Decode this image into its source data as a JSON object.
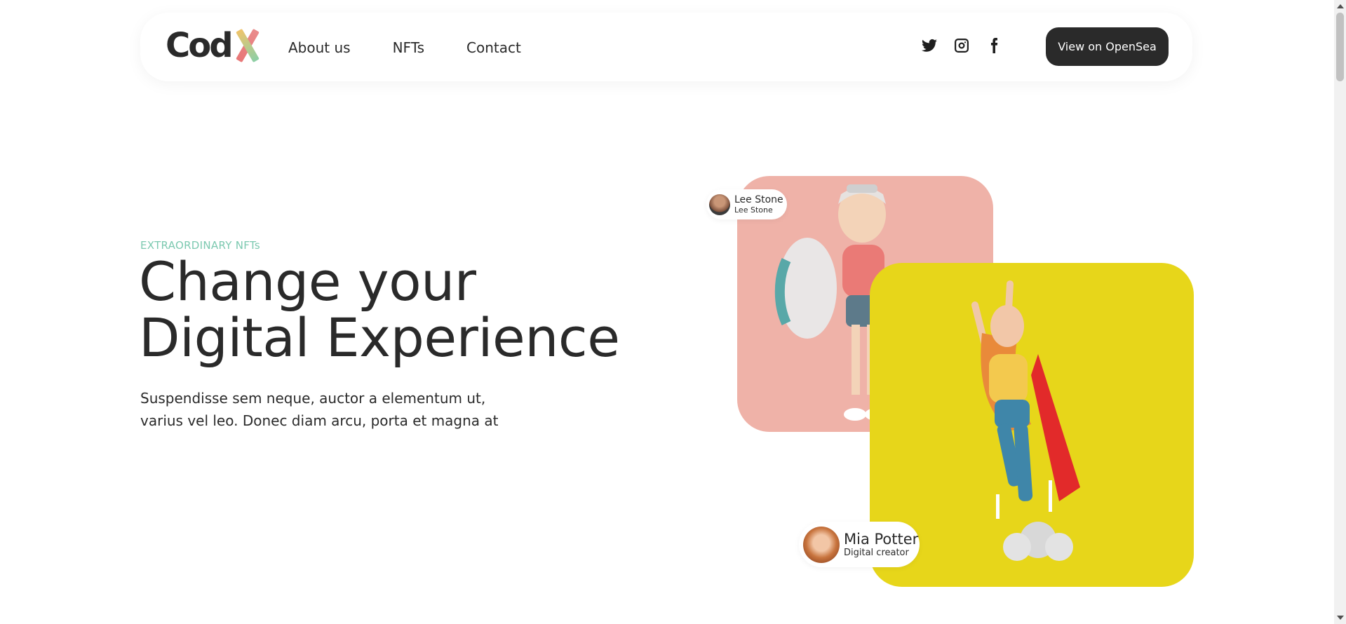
{
  "header": {
    "logo_text": "Cod",
    "logo_accent": "X",
    "nav": [
      {
        "label": "About us"
      },
      {
        "label": "NFTs"
      },
      {
        "label": "Contact"
      }
    ],
    "social_icons": [
      "twitter-icon",
      "instagram-icon",
      "facebook-icon"
    ],
    "cta_label": "View on OpenSea"
  },
  "hero": {
    "eyebrow": "EXTRAORDINARY NFTs",
    "title_line1": "Change your",
    "title_line2": "Digital Experience",
    "text_line1": "Suspendisse sem neque, auctor a elementum ut,",
    "text_line2": "varius vel leo. Donec diam arcu, porta et magna at"
  },
  "cards": {
    "lee": {
      "name": "Lee Stone",
      "role": "Lee Stone"
    },
    "mia": {
      "name": "Mia Potter",
      "role": "Digital creator"
    }
  },
  "colors": {
    "accent_green": "#7cc9b0",
    "pink_card": "#efb2a8",
    "yellow_card": "#e7d61a",
    "dark": "#2a2a2a"
  }
}
